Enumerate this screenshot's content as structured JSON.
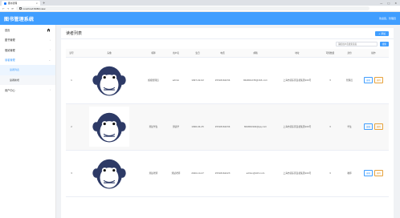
{
  "browser": {
    "tab_title": "图书管理",
    "tab_close": "×",
    "new_tab": "+",
    "url": "localhost:8080/view",
    "nav": {
      "back": "←",
      "forward": "→",
      "reload": "⟳"
    },
    "window_controls": {
      "minimize": "—",
      "maximize": "□",
      "close": "×"
    }
  },
  "header": {
    "brand": "图书管理系统",
    "user_greeting": "欢迎您，管理员"
  },
  "sidebar": {
    "home": "首页",
    "items": [
      {
        "label": "图书管理",
        "arrow": "›"
      },
      {
        "label": "借阅管理",
        "arrow": "›"
      },
      {
        "label": "读者管理",
        "arrow": "⌄"
      }
    ],
    "subitems": [
      {
        "label": "读者列表"
      },
      {
        "label": "读者新增"
      }
    ],
    "personal": {
      "label": "用户中心",
      "arrow": "›"
    }
  },
  "content": {
    "title": "读者列表",
    "add_button": "+ 添加",
    "search_placeholder": "请按用户名搜索读者",
    "search_button": "搜索",
    "columns": [
      "读号",
      "头像",
      "昵称",
      "用户名",
      "生日",
      "电话",
      "邮箱",
      "地址",
      "可借数量",
      "身份",
      "操作"
    ],
    "rows": [
      {
        "id": "1",
        "nickname": "超级管理员",
        "username": "admin",
        "birthday": "1997-02-02",
        "phone": "15518162234",
        "email": "844891235@163.com",
        "address": "上海市浦东区蓝桥集团100号",
        "quota": "3",
        "role": "管理员",
        "edit": "编辑",
        "delete": "删除"
      },
      {
        "id": "2",
        "nickname": "测试学生",
        "username": "测试学",
        "birthday": "1996-04-25",
        "phone": "15518162234",
        "email": "844891904@qq.com",
        "address": "上海市浦东区蓝桥集团100号",
        "quota": "3",
        "role": "学生",
        "edit": "编辑",
        "delete": "删除"
      },
      {
        "id": "3",
        "nickname": "测试老师",
        "username": "测试老师",
        "birthday": "2020-10-27",
        "phone": "15518162223",
        "email": "admin@163.com",
        "address": "上海市浦东区蓝桥集团100号",
        "quota": "3",
        "role": "教师",
        "edit": "编辑",
        "delete": "删除"
      }
    ]
  },
  "colors": {
    "primary": "#409eff",
    "warning": "#e6a23c",
    "avatar": "#2d3a66"
  }
}
